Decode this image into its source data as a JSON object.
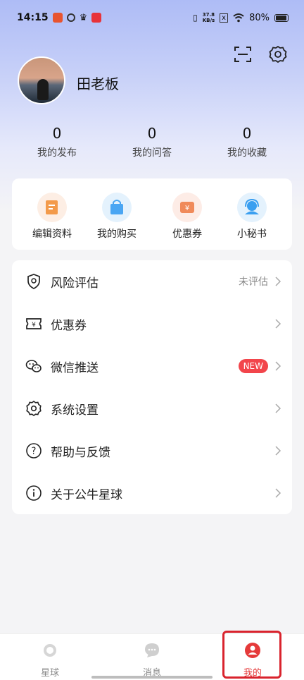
{
  "status_bar": {
    "time": "14:15",
    "speed_value": "37.8",
    "speed_unit": "KB/s",
    "battery": "80%"
  },
  "profile": {
    "name": "田老板"
  },
  "stats": [
    {
      "count": "0",
      "label": "我的发布"
    },
    {
      "count": "0",
      "label": "我的问答"
    },
    {
      "count": "0",
      "label": "我的收藏"
    }
  ],
  "quick_actions": [
    {
      "label": "编辑资料",
      "icon": "edit-profile-icon",
      "color": "#f39a4a"
    },
    {
      "label": "我的购买",
      "icon": "shopping-bag-icon",
      "color": "#4aa6f3"
    },
    {
      "label": "优惠券",
      "icon": "coupon-icon",
      "color": "#f08a5a"
    },
    {
      "label": "小秘书",
      "icon": "assistant-icon",
      "color": "#3a9ff0"
    }
  ],
  "menu": [
    {
      "label": "风险评估",
      "status": "未评估",
      "icon": "shield-icon"
    },
    {
      "label": "优惠券",
      "icon": "ticket-icon"
    },
    {
      "label": "微信推送",
      "badge": "NEW",
      "icon": "wechat-icon"
    },
    {
      "label": "系统设置",
      "icon": "gear-icon"
    },
    {
      "label": "帮助与反馈",
      "icon": "help-icon"
    },
    {
      "label": "关于公牛星球",
      "icon": "info-icon"
    }
  ],
  "bottom_nav": [
    {
      "label": "星球",
      "icon": "planet-icon"
    },
    {
      "label": "消息",
      "icon": "message-icon"
    },
    {
      "label": "我的",
      "icon": "user-icon",
      "active": true
    }
  ],
  "colors": {
    "accent": "#e53a3a",
    "badge": "#f2454b",
    "header_gradient_top": "#aebcf6"
  }
}
